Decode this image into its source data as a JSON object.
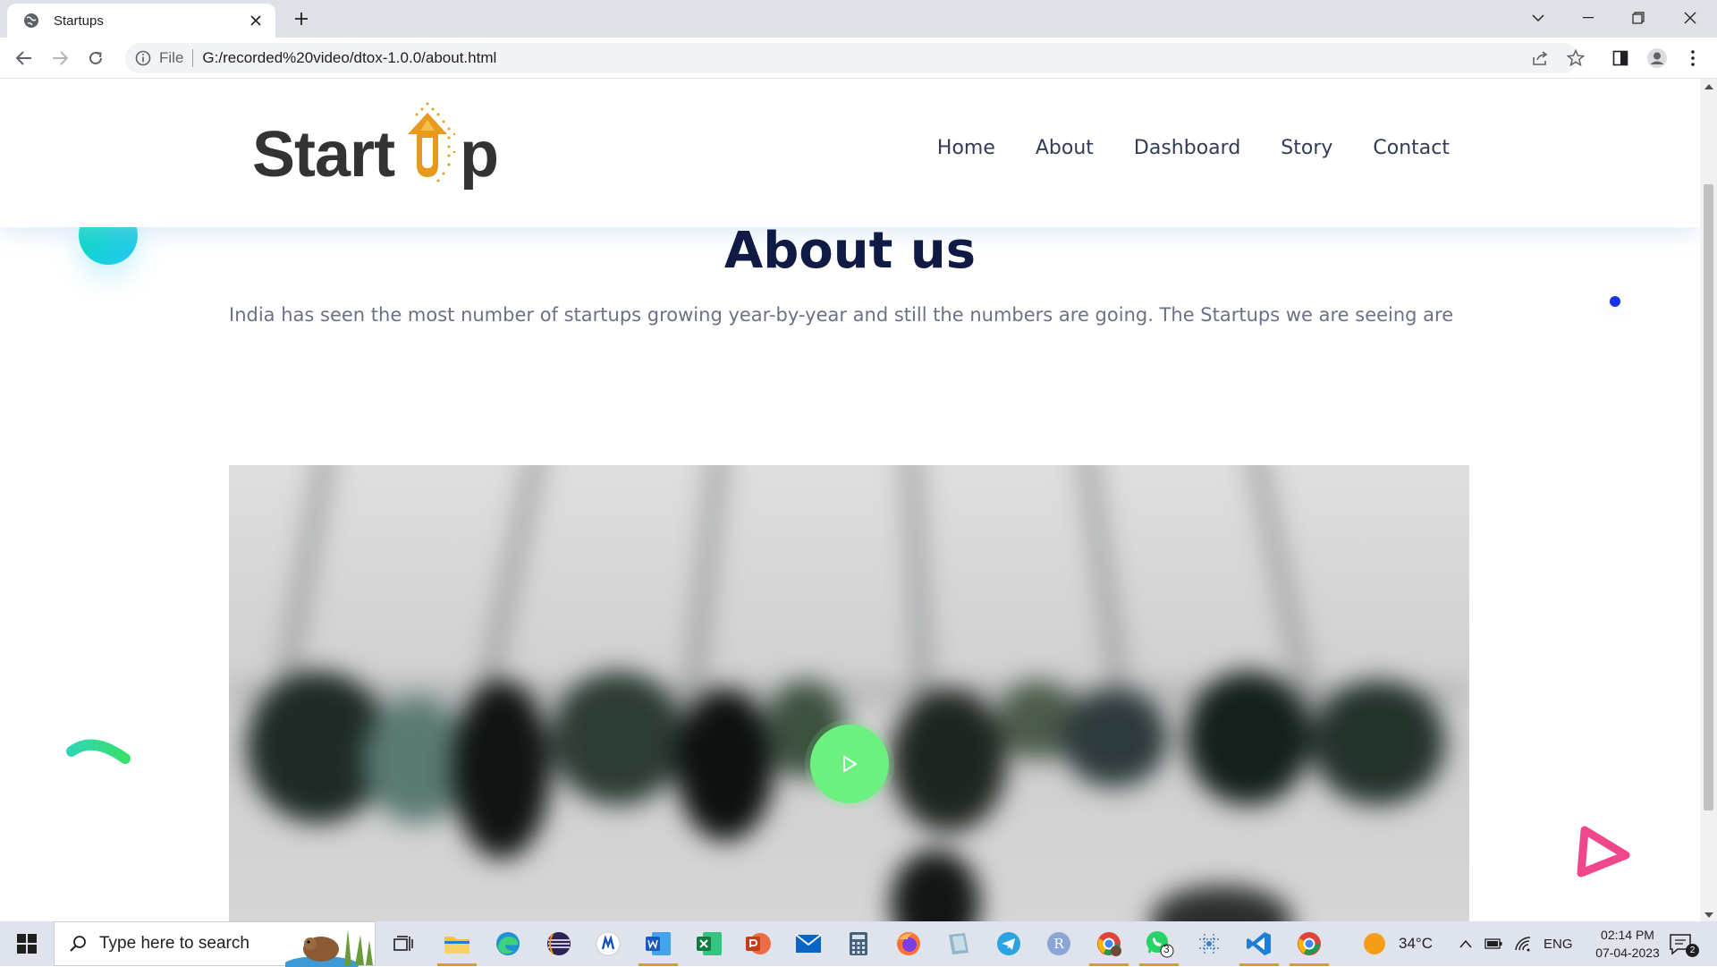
{
  "browser": {
    "tab_title": "Startups",
    "url_scheme": "File",
    "url": "G:/recorded%20video/dtox-1.0.0/about.html"
  },
  "site": {
    "logo_text_left": "Start",
    "logo_text_right": "p",
    "nav": [
      "Home",
      "About",
      "Dashboard",
      "Story",
      "Contact"
    ],
    "section_title": "About us",
    "section_text": "India has seen the most number of startups growing year-by-year and still the numbers are going. The Startups we are seeing are"
  },
  "taskbar": {
    "search_placeholder": "Type here to search",
    "whatsapp_badge": "3",
    "weather": "34°C",
    "language": "ENG",
    "time": "02:14 PM",
    "date": "07-04-2023",
    "notifications": "2"
  },
  "colors": {
    "accent_play": "#6cf07f",
    "title": "#0f1a45",
    "deco_dot": "#1733e8",
    "deco_triangle": "#f0468c"
  }
}
